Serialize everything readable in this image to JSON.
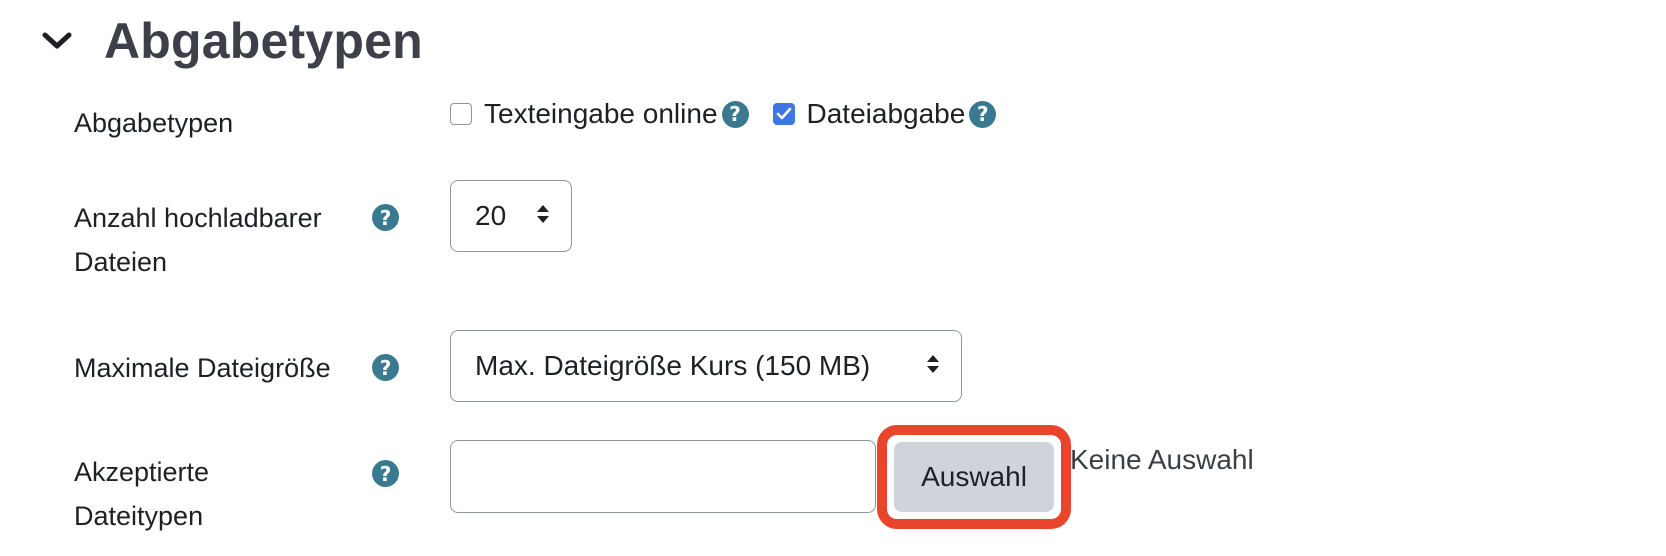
{
  "section": {
    "title": "Abgabetypen",
    "collapse_icon": "chevron-down-icon"
  },
  "submission_types": {
    "label": "Abgabetypen",
    "options": [
      {
        "label": "Texteingabe online",
        "checked": false
      },
      {
        "label": "Dateiabgabe",
        "checked": true
      }
    ]
  },
  "max_files": {
    "label_line1": "Anzahl hochladbarer",
    "label_line2": "Dateien",
    "selected_value": "20"
  },
  "max_size": {
    "label": "Maximale Dateigröße",
    "selected_value": "Max. Dateigröße Kurs (150 MB)"
  },
  "accepted_types": {
    "label_line1": "Akzeptierte",
    "label_line2": "Dateitypen",
    "input_value": "",
    "button_label": "Auswahl",
    "status_text": "Keine Auswahl"
  },
  "help_icon_glyph": "?",
  "colors": {
    "accent_checkbox": "#3f76e4",
    "help_icon": "#3a7a91",
    "highlight_border": "#e8452c",
    "button_bg": "#ced4da"
  }
}
